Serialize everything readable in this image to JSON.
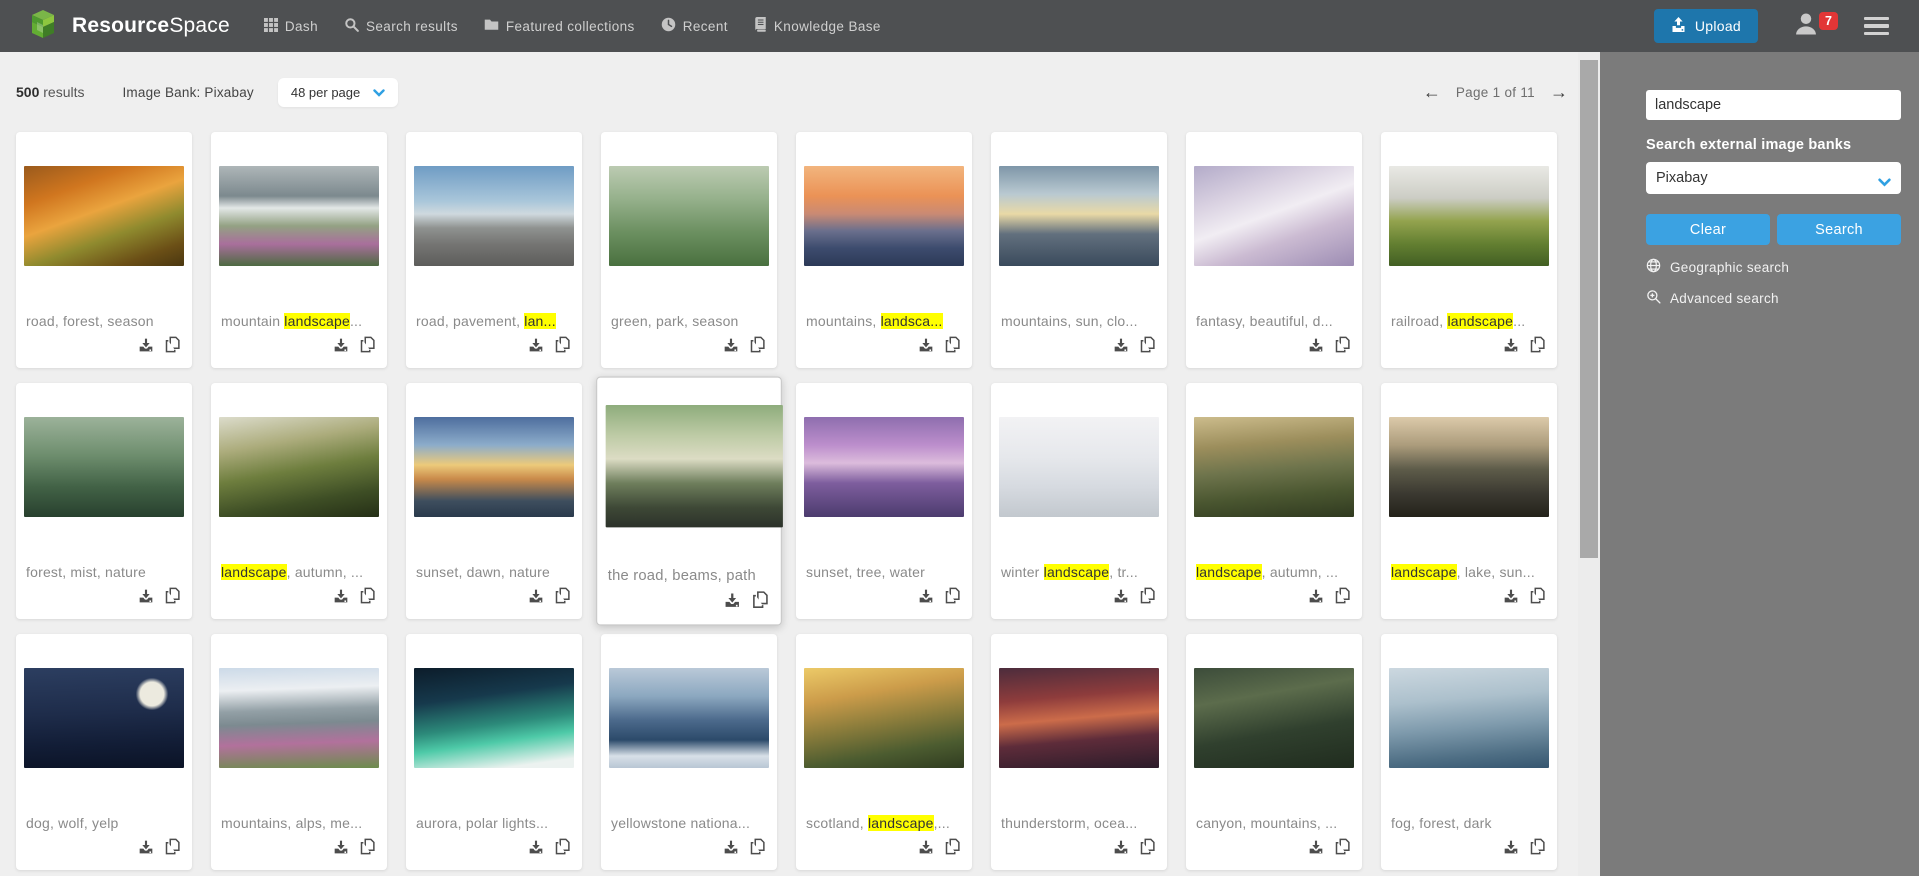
{
  "navbar": {
    "brand_bold": "Resource",
    "brand_light": "Space",
    "items": [
      {
        "label": "Dash",
        "icon": "grid-icon"
      },
      {
        "label": "Search results",
        "icon": "search-icon"
      },
      {
        "label": "Featured collections",
        "icon": "folder-icon"
      },
      {
        "label": "Recent",
        "icon": "clock-icon"
      },
      {
        "label": "Knowledge Base",
        "icon": "book-icon"
      }
    ],
    "upload_label": "Upload",
    "notification_count": "7"
  },
  "toolbar": {
    "result_count": "500",
    "results_label": "results",
    "source_label": "Image Bank: Pixabay",
    "per_page": "48 per page",
    "pagination": "Page 1 of 11",
    "prev_arrow": "←",
    "next_arrow": "→"
  },
  "sidebar": {
    "search_value": "landscape",
    "external_label": "Search external image banks",
    "provider": "Pixabay",
    "clear_label": "Clear",
    "search_label": "Search",
    "links": [
      {
        "label": "Geographic search",
        "icon": "globe-icon"
      },
      {
        "label": "Advanced search",
        "icon": "search-plus-icon"
      }
    ]
  },
  "colors": {
    "navbar_bg": "#4e5052",
    "page_bg": "#efefef",
    "sidebar_bg": "#7b7b7b",
    "upload_blue": "#1e76ac",
    "button_blue": "#3ba2e2",
    "badge_red": "#e23636",
    "highlight_yellow": "#ffff00",
    "caption_gray": "#8a8a8a"
  },
  "results": [
    {
      "pre": "road, forest, season",
      "hl": "",
      "post": "",
      "bg": "linear-gradient(160deg,#9a5a1c 0%,#d0761f 25%,#eaa43e 45%,#8f8a2e 65%,#6b4f16 85%,#4a3710 100%)"
    },
    {
      "pre": "mountain ",
      "hl": "landscape",
      "post": "...",
      "bg": "linear-gradient(180deg,#aeb6b8 0%,#7c898e 30%,#e3e8e7 42%,#93a183 60%,#a96f9c 78%,#4e6a42 100%)"
    },
    {
      "pre": "road, pavement, ",
      "hl": "lan...",
      "post": "",
      "bg": "linear-gradient(180deg,#6f9cc4 0%,#a9c6da 35%,#cfd9de 48%,#8f9290 62%,#757573 78%,#5d5d5b 100%)"
    },
    {
      "pre": "green, park, season",
      "hl": "",
      "post": "",
      "bg": "linear-gradient(180deg,#bccbb2 0%,#93af89 35%,#6d9162 65%,#49703f 100%)"
    },
    {
      "pre": "mountains, ",
      "hl": "landsca...",
      "post": "",
      "bg": "linear-gradient(180deg,#f2b57e 0%,#eb9256 30%,#c98a74 48%,#6a6f8d 65%,#3d4c6e 82%,#2c3a57 100%)"
    },
    {
      "pre": "mountains, sun, clo...",
      "hl": "",
      "post": "",
      "bg": "linear-gradient(180deg,#7e96a8 0%,#b9c9d1 28%,#e9d9a6 48%,#62707e 68%,#3a4a5c 100%)"
    },
    {
      "pre": "fantasy, beautiful, d...",
      "hl": "",
      "post": "",
      "bg": "linear-gradient(160deg,#b3abc9 0%,#d9d1e1 28%,#f1edf3 48%,#cbbbd2 68%,#9c8cb3 100%)"
    },
    {
      "pre": "railroad, ",
      "hl": "landscape",
      "post": "...",
      "bg": "linear-gradient(180deg,#e9e9e5 0%,#cccdc5 32%,#93a34e 55%,#637f31 78%,#425f23 100%)"
    },
    {
      "pre": "forest, mist, nature",
      "hl": "",
      "post": "",
      "bg": "linear-gradient(180deg,#9cb29a 0%,#6e8e6e 38%,#426246 70%,#28402e 100%)"
    },
    {
      "pre": "",
      "hl": "landscape",
      "post": ", autumn, ...",
      "bg": "linear-gradient(170deg,#dcdccb 0%,#acac7c 28%,#6e7e3e 52%,#3e4e25 78%,#252f16 100%)"
    },
    {
      "pre": "sunset, dawn, nature",
      "hl": "",
      "post": "",
      "bg": "linear-gradient(180deg,#4e6e9e 0%,#8cacca 28%,#ecca7a 48%,#c98a4a 62%,#3e4e5e 84%,#2a3a4c 100%)"
    },
    {
      "pre": "the road, beams, path",
      "hl": "",
      "post": "",
      "selected": true,
      "bg": "linear-gradient(180deg,#8eac7c 0%,#bccaa4 24%,#dcdcc4 44%,#6e7e5c 64%,#3e4836 84%,#2c322a 100%)"
    },
    {
      "pre": "sunset, tree, water",
      "hl": "",
      "post": "",
      "bg": "linear-gradient(180deg,#8e6eae 0%,#bc8ecc 28%,#dcbcdc 46%,#7e5e9e 66%,#4c3c6e 100%)"
    },
    {
      "pre": "winter ",
      "hl": "landscape",
      "post": ", tr...",
      "bg": "linear-gradient(180deg,#f2f2f4 0%,#e6e8ec 40%,#d6dae0 70%,#c2c8ce 100%)"
    },
    {
      "pre": "",
      "hl": "landscape",
      "post": ", autumn, ...",
      "bg": "linear-gradient(175deg,#ccbc8c 0%,#9c8e5c 28%,#6e744c 52%,#4a5630 76%,#303a20 100%)"
    },
    {
      "pre": "",
      "hl": "landscape",
      "post": ", lake, sun...",
      "bg": "linear-gradient(180deg,#dccaaa 0%,#ac9c7c 28%,#5e5c4a 52%,#3c3a32 76%,#24221a 100%)"
    },
    {
      "pre": "dog, wolf, yelp",
      "hl": "",
      "post": "",
      "bg": "radial-gradient(circle at 80% 26%,#eceadf 0%,#eceadf 8%,rgba(236,234,223,0) 11%),linear-gradient(178deg,#2c3e60 0%,#1e2c4a 45%,#121d36 75%,#0b1326 100%)"
    },
    {
      "pre": "mountains, alps, me...",
      "hl": "",
      "post": "",
      "bg": "linear-gradient(178deg,#ccdae8 0%,#eceff2 22%,#93a0a6 42%,#7c8a90 55%,#b2719c 74%,#6c8c4c 100%)"
    },
    {
      "pre": "aurora, polar lights...",
      "hl": "",
      "post": "",
      "bg": "linear-gradient(172deg,#0c1c2a 0%,#16394c 30%,#2c8a7a 55%,#4ecaa8 70%,#ecf2f0 92%)"
    },
    {
      "pre": "yellowstone nationa...",
      "hl": "",
      "post": "",
      "bg": "linear-gradient(180deg,#bac9d8 0%,#8ca8c0 28%,#4c6a8c 52%,#2c4a6a 72%,#d8e0e8 88%,#b8c6d4 100%)"
    },
    {
      "pre": "scotland, ",
      "hl": "landscape",
      "post": ",...",
      "bg": "linear-gradient(170deg,#ecca68 0%,#cc9c4a 28%,#8e7e3c 52%,#4c5c30 78%,#303c20 100%)"
    },
    {
      "pre": "thunderstorm, ocea...",
      "hl": "",
      "post": "",
      "bg": "linear-gradient(175deg,#4c2c3c 0%,#8e3c3c 30%,#cc6c4a 50%,#5e2c3a 70%,#2c1c2a 100%)"
    },
    {
      "pre": "canyon, mountains, ...",
      "hl": "",
      "post": "",
      "bg": "linear-gradient(170deg,#3c4c3a 0%,#5c6c4c 30%,#30402e 62%,#202c1e 100%)"
    },
    {
      "pre": "fog, forest, dark",
      "hl": "",
      "post": "",
      "bg": "linear-gradient(175deg,#ccd8e0 0%,#acc0cc 32%,#7e9aac 58%,#4e6e84 84%,#365670 100%)"
    }
  ]
}
